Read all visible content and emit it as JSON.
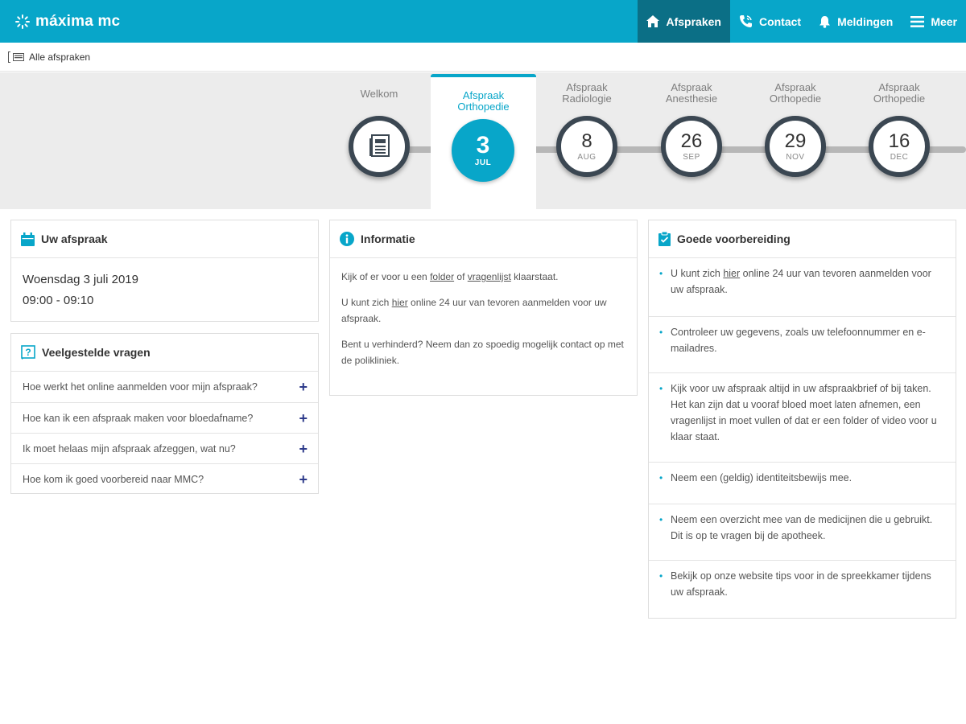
{
  "header": {
    "logo_text": "máxima mc",
    "nav": [
      {
        "label": "Afspraken",
        "icon": "home-icon",
        "active": true
      },
      {
        "label": "Contact",
        "icon": "phone-icon",
        "active": false
      },
      {
        "label": "Meldingen",
        "icon": "bell-icon",
        "active": false
      },
      {
        "label": "Meer",
        "icon": "menu-icon",
        "active": false
      }
    ],
    "accent_color": "#08a6c9",
    "active_color": "#0b6f86"
  },
  "breadcrumb": {
    "label": "Alle afspraken"
  },
  "timeline": {
    "welcome": {
      "label": "Welkom",
      "icon": "document-icon"
    },
    "active": {
      "line1": "Afspraak",
      "line2": "Orthopedie",
      "day": "3",
      "month": "JUL"
    },
    "steps": [
      {
        "line1": "Afspraak",
        "line2": "Radiologie",
        "day": "8",
        "month": "AUG"
      },
      {
        "line1": "Afspraak",
        "line2": "Anesthesie",
        "day": "26",
        "month": "SEP"
      },
      {
        "line1": "Afspraak",
        "line2": "Orthopedie",
        "day": "29",
        "month": "NOV"
      },
      {
        "line1": "Afspraak",
        "line2": "Orthopedie",
        "day": "16",
        "month": "DEC"
      }
    ]
  },
  "appointment": {
    "title": "Uw afspraak",
    "date": "Woensdag 3 juli 2019",
    "time": "09:00 - 09:10"
  },
  "faq": {
    "title": "Veelgestelde vragen",
    "items": [
      "Hoe werkt het online aanmelden voor mijn afspraak?",
      "Hoe kan ik een afspraak maken voor bloedafname?",
      "Ik moet helaas mijn afspraak afzeggen, wat nu?",
      "Hoe kom ik goed voorbereid naar MMC?"
    ]
  },
  "info": {
    "title": "Informatie",
    "p1_a": "Kijk of er voor u een ",
    "p1_link1": "folder",
    "p1_b": " of ",
    "p1_link2": "vragenlijst",
    "p1_c": " klaarstaat.",
    "p2_a": "U kunt zich ",
    "p2_link": "hier",
    "p2_b": " online 24 uur van tevoren aanmelden voor uw afspraak.",
    "p3": "Bent u verhinderd? Neem dan zo spoedig mogelijk contact op met de polikliniek."
  },
  "prep": {
    "title": "Goede voorbereiding",
    "item1_a": "U kunt zich ",
    "item1_link": "hier",
    "item1_b": " online 24 uur van tevoren aanmelden voor uw afspraak.",
    "items": [
      "Controleer uw gegevens, zoals uw telefoonnummer en e-mailadres.",
      "Kijk voor uw afspraak altijd in uw afspraakbrief of bij taken. Het kan zijn dat u vooraf bloed moet laten afnemen, een vragenlijst in moet vullen of dat er een folder of video voor u klaar staat.",
      "Neem een (geldig) identiteitsbewijs mee.",
      "Neem een overzicht mee van de medicijnen die u gebruikt. Dit is op te vragen bij de apotheek.",
      "Bekijk op onze website tips voor in de spreekkamer tijdens uw afspraak."
    ]
  }
}
